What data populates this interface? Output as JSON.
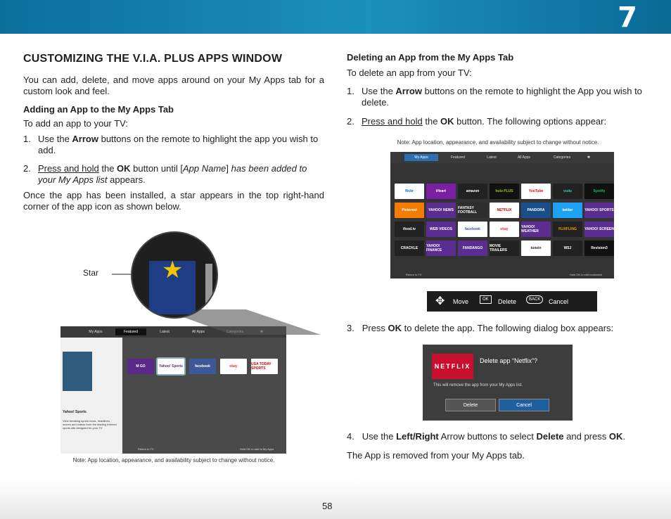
{
  "header": {
    "chapter": "7"
  },
  "footer": {
    "page_number": "58"
  },
  "left": {
    "title": "CUSTOMIZING THE V.I.A. PLUS APPS WINDOW",
    "intro": "You can add, delete, and move apps around on your My Apps tab for a custom look and feel.",
    "add_heading": "Adding an App to the My Apps Tab",
    "add_lead": "To add an app to your TV:",
    "step1_num": "1.",
    "step1_a": "Use the ",
    "step1_b": "Arrow",
    "step1_c": " buttons on the remote to highlight the app you wish to add.",
    "step2_num": "2.",
    "step2_a": "Press and hold",
    "step2_b": " the ",
    "step2_c": "OK",
    "step2_d": " button until [",
    "step2_e": "App Name",
    "step2_f": "] ",
    "step2_g": "has been added to your My Apps list",
    "step2_h": " appears.",
    "installed": "Once the app has been installed, a star appears in the top right-hand corner of the app icon as shown below.",
    "callout_label": "Star",
    "note": "Note: App location, appearance, and availability subject to change without notice.",
    "screenshot": {
      "tabs": [
        "My Apps",
        "Featured",
        "Latest",
        "All Apps",
        "Categories"
      ],
      "app_title": "Yahoo! Sports",
      "app_desc": "View breaking sports news, headlines, scores and videos from the leading Internet sports site designed for your TV.",
      "tiles": [
        "M GO",
        "Yahoo! Sports",
        "facebook",
        "ebay",
        "USA TODAY SPORTS"
      ],
      "bottom_left": "Return to TV",
      "bottom_right": "Hold OK to add to My Apps"
    }
  },
  "right": {
    "delete_heading": "Deleting an App from the My Apps Tab",
    "delete_lead": "To delete an app from your TV:",
    "step1_num": "1.",
    "step1_a": "Use the ",
    "step1_b": "Arrow",
    "step1_c": " buttons on the remote to highlight the App you wish to delete.",
    "step2_num": "2.",
    "step2_a": "Press and hold",
    "step2_b": " the ",
    "step2_c": "OK",
    "step2_d": " button. The following options appear:",
    "note": "Note: App location, appearance, and availability subject to change without notice.",
    "step3_num": "3.",
    "step3_a": "Press ",
    "step3_b": "OK",
    "step3_c": " to delete the app. The following dialog box appears:",
    "step4_num": "4.",
    "step4_a": "Use the ",
    "step4_b": "Left/Right",
    "step4_c": " Arrow buttons to select ",
    "step4_d": "Delete",
    "step4_e": " and press ",
    "step4_f": "OK",
    "step4_g": ".",
    "removed": "The App is removed from your My Apps tab.",
    "screenshot": {
      "tabs": [
        "My Apps",
        "Featured",
        "Latest",
        "All Apps",
        "Categories"
      ],
      "tiles": [
        "flickr",
        "iHeart",
        "amazon",
        "hulu PLUS",
        "YouTube",
        "vudu",
        "Spotify",
        "Pinterest",
        "YAHOO! NEWS",
        "FANTASY FOOTBALL",
        "NETFLIX",
        "PANDORA",
        "twitter",
        "YAHOO! SPORTS",
        "ifood.tv",
        "WEB VIDEOS",
        "facebook",
        "ebay",
        "YAHOO! WEATHER",
        "FLIXFLING",
        "YAHOO! SCREEN",
        "CRACKLE",
        "YAHOO! FINANCE",
        "FANDANGO",
        "MOVIE TRAILERS",
        "tunein",
        "WSJ",
        "Revision3"
      ],
      "bottom_left": "Return to TV",
      "bottom_right": "Hold OK to edit bookmark"
    },
    "controls": {
      "move": "Move",
      "ok_key": "OK",
      "delete": "Delete",
      "back_key": "BACK",
      "cancel": "Cancel"
    },
    "dialog": {
      "logo": "NETFLIX",
      "title": "Delete app “Netflix”?",
      "subtitle": "This will remove the app from your My Apps list.",
      "delete_btn": "Delete",
      "cancel_btn": "Cancel"
    }
  }
}
